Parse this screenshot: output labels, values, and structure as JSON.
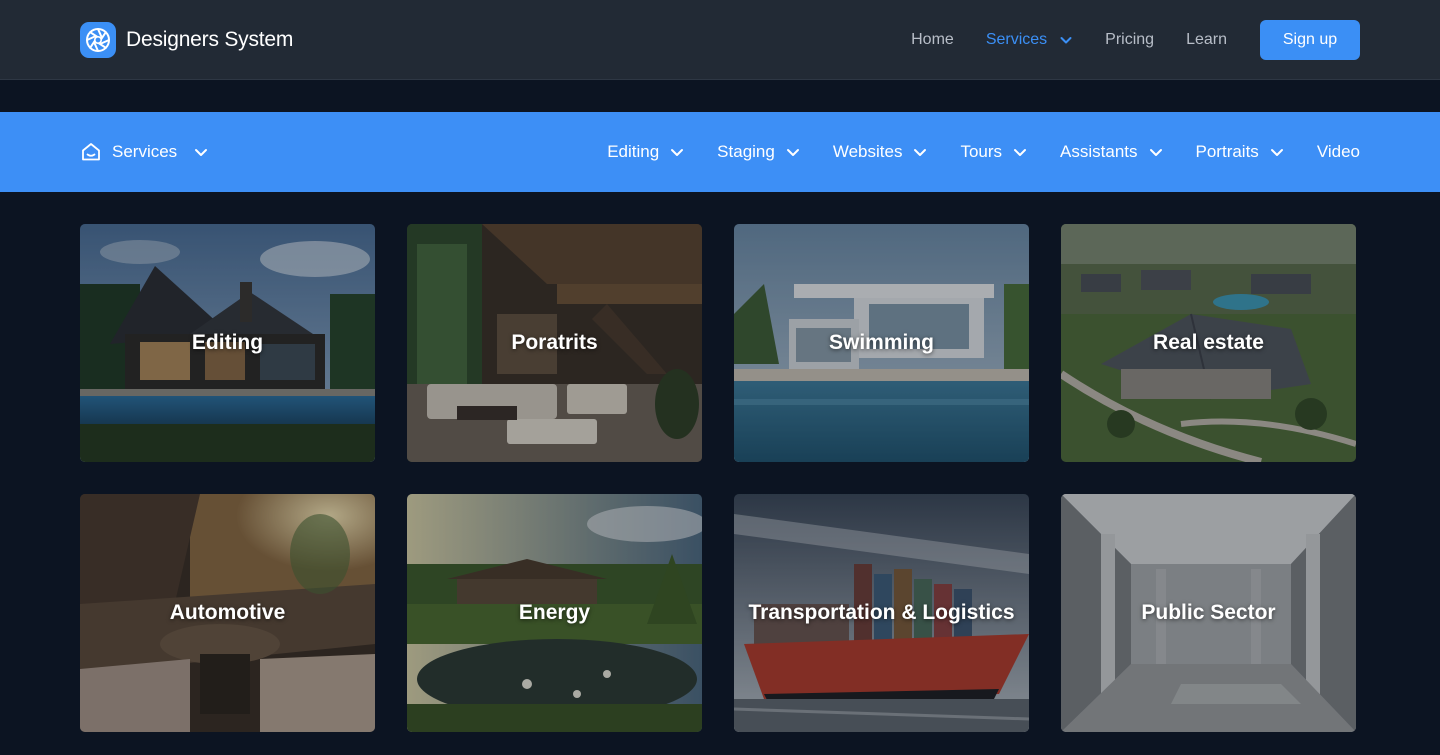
{
  "brand": {
    "name": "Designers System",
    "logo_icon": "aperture-icon"
  },
  "topnav": {
    "items": [
      {
        "label": "Home",
        "active": false
      },
      {
        "label": "Services",
        "active": true,
        "has_dropdown": true
      },
      {
        "label": "Pricing",
        "active": false
      },
      {
        "label": "Learn",
        "active": false
      }
    ],
    "signup_label": "Sign up"
  },
  "subnav": {
    "home_icon": "home-icon",
    "services_label": "Services",
    "items": [
      {
        "label": "Editing",
        "has_dropdown": true
      },
      {
        "label": "Staging",
        "has_dropdown": true
      },
      {
        "label": "Websites",
        "has_dropdown": true
      },
      {
        "label": "Tours",
        "has_dropdown": true
      },
      {
        "label": "Assistants",
        "has_dropdown": true
      },
      {
        "label": "Portraits",
        "has_dropdown": true
      },
      {
        "label": "Video",
        "has_dropdown": false
      }
    ]
  },
  "cards": [
    {
      "title": "Editing"
    },
    {
      "title": "Poratrits"
    },
    {
      "title": "Swimming"
    },
    {
      "title": "Real estate"
    },
    {
      "title": "Automotive"
    },
    {
      "title": "Energy"
    },
    {
      "title": "Transportation & Logistics"
    },
    {
      "title": "Public Sector"
    }
  ],
  "colors": {
    "header_bg": "#222a35",
    "page_bg": "#0c1422",
    "accent": "#3b8ff5",
    "subnav_bg": "#3d8ff6",
    "nav_text": "#b8bec8"
  }
}
